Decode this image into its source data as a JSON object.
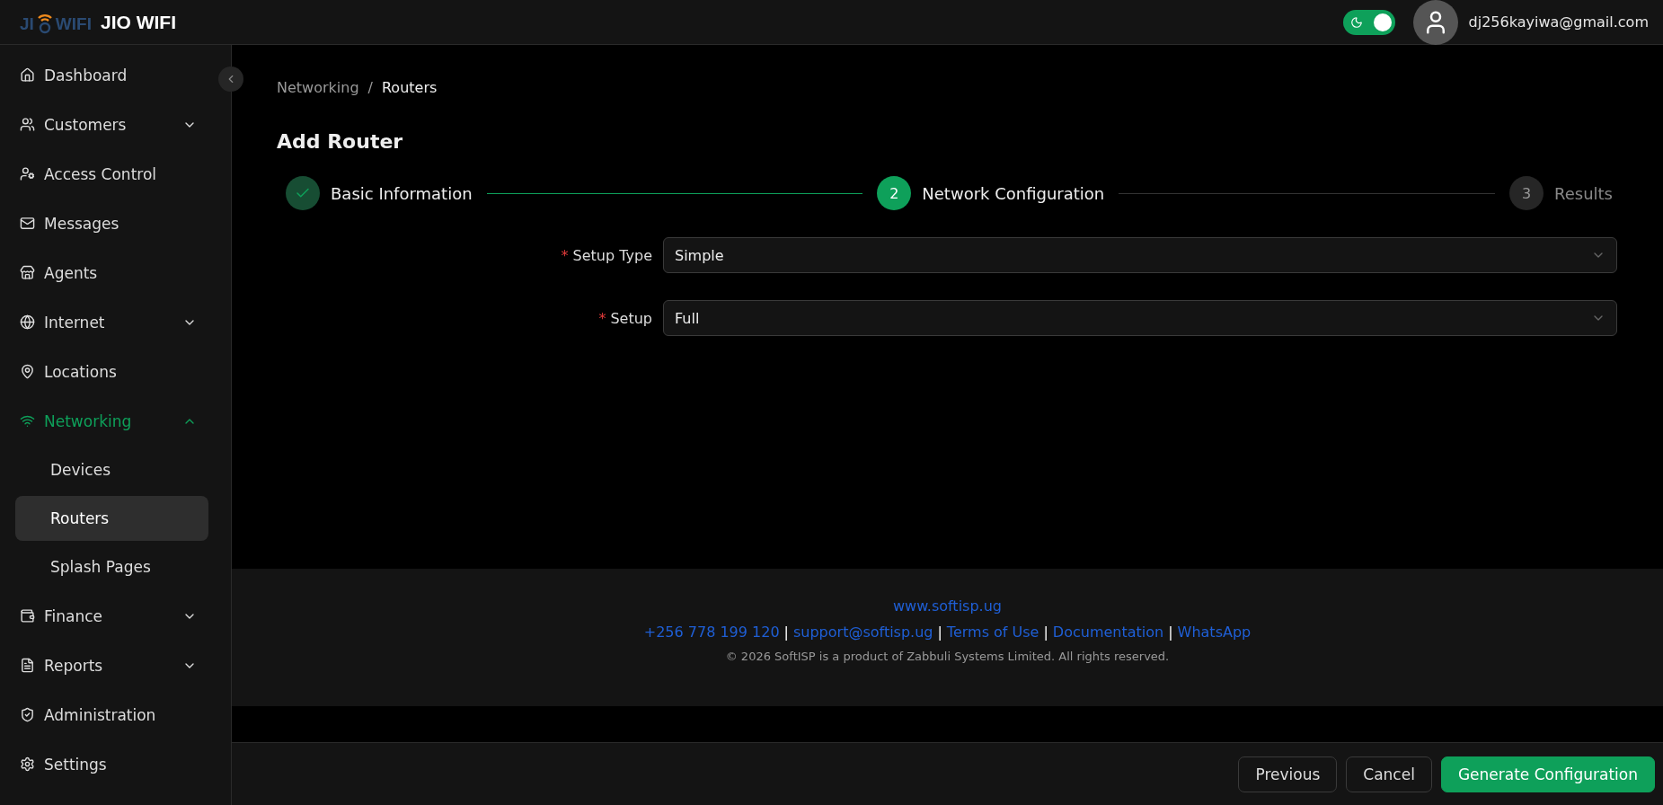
{
  "header": {
    "logo": {
      "left": "JI",
      "right": "WIFI"
    },
    "app_name": "JIO WIFI",
    "theme_toggle": {
      "on": true
    },
    "user_email": "dj256kayiwa@gmail.com"
  },
  "sidebar": {
    "items": [
      {
        "kind": "home",
        "label": "Dashboard",
        "selected": false
      },
      {
        "kind": "customers",
        "label": "Customers",
        "selected": false,
        "expanded": false
      },
      {
        "kind": "access",
        "label": "Access Control",
        "selected": false
      },
      {
        "kind": "mail",
        "label": "Messages",
        "selected": false
      },
      {
        "kind": "store",
        "label": "Agents",
        "selected": false
      },
      {
        "kind": "globe",
        "label": "Internet",
        "selected": false,
        "expanded": false
      },
      {
        "kind": "pin",
        "label": "Locations",
        "selected": false
      },
      {
        "kind": "wifi",
        "label": "Networking",
        "selected": false,
        "expanded": true,
        "children": [
          {
            "label": "Devices",
            "selected": false
          },
          {
            "label": "Routers",
            "selected": true
          },
          {
            "label": "Splash Pages",
            "selected": false
          }
        ]
      },
      {
        "kind": "wallet",
        "label": "Finance",
        "selected": false,
        "expanded": false
      },
      {
        "kind": "file",
        "label": "Reports",
        "selected": false,
        "expanded": false
      },
      {
        "kind": "shield",
        "label": "Administration",
        "selected": false
      },
      {
        "kind": "gear",
        "label": "Settings",
        "selected": false
      }
    ]
  },
  "breadcrumb": [
    "Networking",
    "Routers"
  ],
  "breadcrumb_separator": "/",
  "page_title": "Add Router",
  "steps": [
    {
      "label": "Basic Information",
      "completed": true,
      "current": false
    },
    {
      "number": "2",
      "label": "Network Configuration",
      "completed": false,
      "current": true
    },
    {
      "number": "3",
      "label": "Results",
      "completed": false,
      "current": false
    }
  ],
  "form": {
    "fields": [
      {
        "label": "Setup Type",
        "required": true,
        "value": "Simple"
      },
      {
        "label": "Setup",
        "required": true,
        "value": "Full"
      }
    ],
    "required_mark": "*"
  },
  "footer": {
    "website": "www.softisp.ug",
    "separator": "|",
    "links": [
      "+256 778 199 120",
      "support@softisp.ug",
      "Terms of Use",
      "Documentation",
      "WhatsApp"
    ],
    "copyright": "© 2026 SoftISP is a product of Zabbuli Systems Limited. All rights reserved."
  },
  "actions": [
    {
      "label": "Previous",
      "kind": "secondary"
    },
    {
      "label": "Cancel",
      "kind": "secondary"
    },
    {
      "label": "Generate Configuration",
      "kind": "primary"
    }
  ]
}
